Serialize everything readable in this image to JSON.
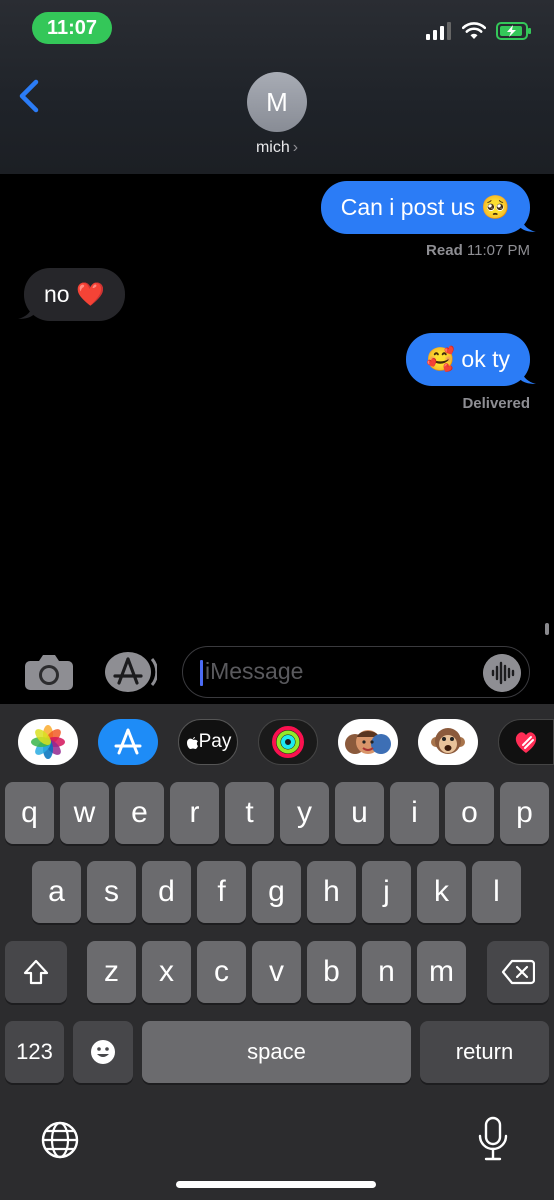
{
  "status_bar": {
    "time": "11:07",
    "icons": [
      "cellular-signal-icon",
      "wifi-icon",
      "battery-charging-icon"
    ]
  },
  "header": {
    "back_icon": "chevron-left-icon",
    "avatar_initial": "M",
    "contact_name": "mich",
    "contact_chevron": "›"
  },
  "messages": [
    {
      "direction": "outgoing",
      "text": "Can i post us",
      "emoji": "🥺"
    },
    {
      "direction": "incoming",
      "text": "no",
      "emoji": "❤️"
    },
    {
      "direction": "outgoing",
      "text": "ok ty",
      "emoji": "🥰"
    }
  ],
  "receipts": {
    "read_label": "Read",
    "read_time": "11:07 PM",
    "delivered": "Delivered"
  },
  "input": {
    "placeholder": "iMessage",
    "camera_icon": "camera-icon",
    "apps_icon": "app-store-icon",
    "audio_icon": "audio-waveform-icon"
  },
  "app_strip": {
    "apps": [
      "photos-app-icon",
      "app-store-app-icon",
      "apple-pay-app-icon",
      "fitness-app-icon",
      "memoji-stickers-app-icon",
      "animoji-app-icon",
      "heart-stickers-app-icon"
    ],
    "apple_pay_label": "Pay"
  },
  "keyboard": {
    "row1": [
      "q",
      "w",
      "e",
      "r",
      "t",
      "y",
      "u",
      "i",
      "o",
      "p"
    ],
    "row2": [
      "a",
      "s",
      "d",
      "f",
      "g",
      "h",
      "j",
      "k",
      "l"
    ],
    "row3": [
      "z",
      "x",
      "c",
      "v",
      "b",
      "n",
      "m"
    ],
    "numbers_label": "123",
    "space_label": "space",
    "return_label": "return",
    "shift_icon": "shift-icon",
    "delete_icon": "backspace-icon",
    "emoji_icon": "emoji-icon",
    "globe_icon": "globe-icon",
    "dictation_icon": "microphone-icon"
  },
  "colors": {
    "accent_blue": "#2b7cf6",
    "status_green": "#34c759",
    "incoming_bubble": "#26262a"
  }
}
